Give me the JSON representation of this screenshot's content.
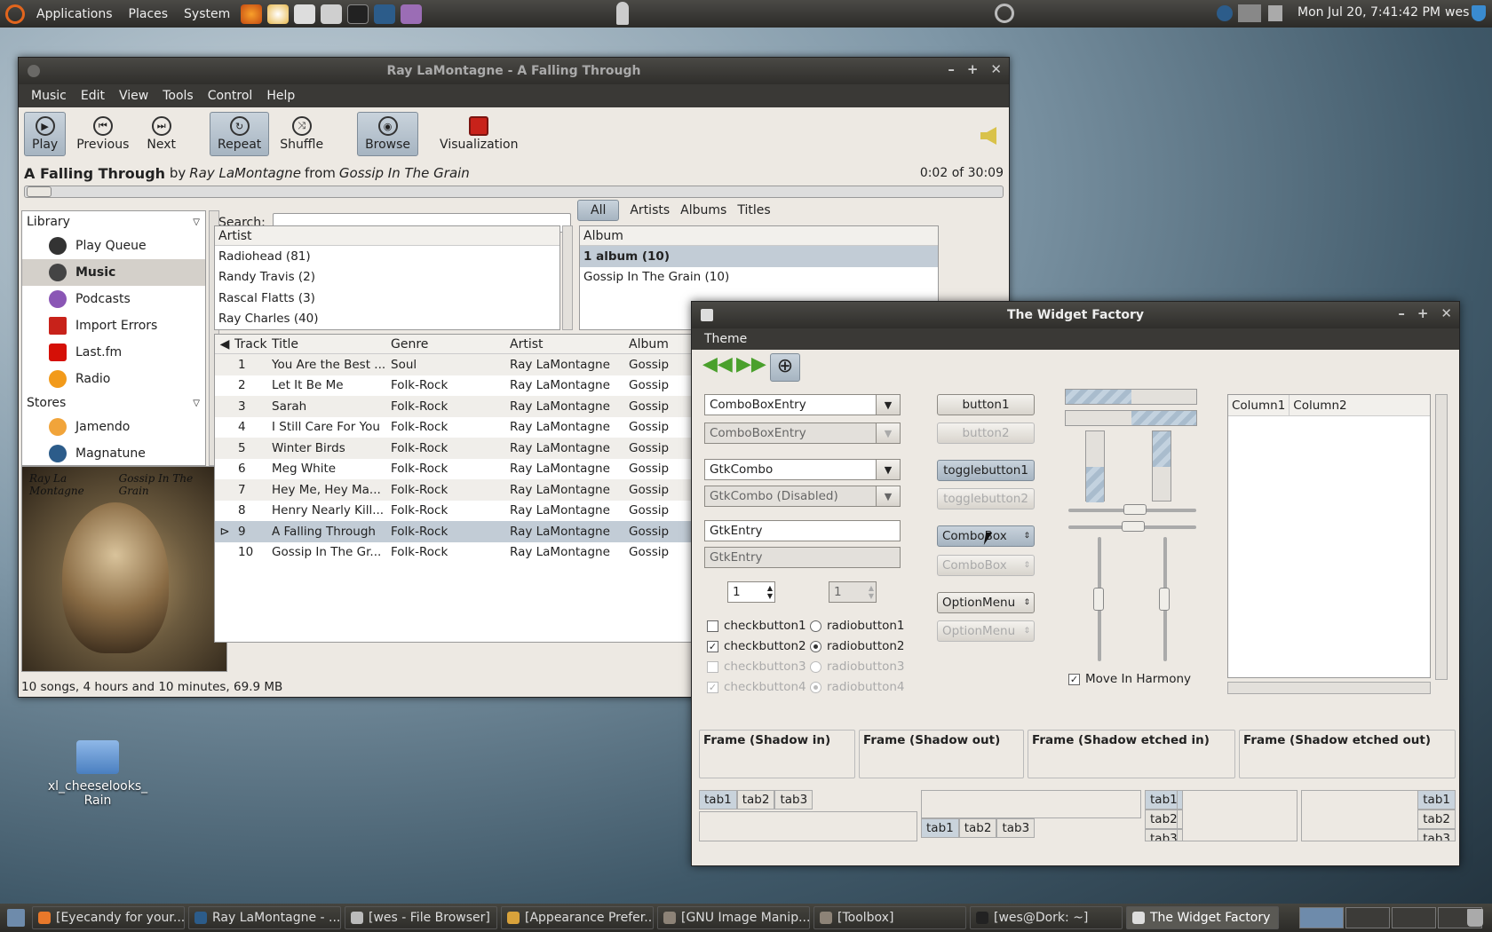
{
  "top_panel": {
    "menus": [
      "Applications",
      "Places",
      "System"
    ],
    "clock": "Mon Jul 20,  7:41:42 PM",
    "user": "wes"
  },
  "rhythmbox": {
    "title": "Ray LaMontagne - A Falling Through",
    "menus": [
      "Music",
      "Edit",
      "View",
      "Tools",
      "Control",
      "Help"
    ],
    "toolbar": [
      "Play",
      "Previous",
      "Next",
      "Repeat",
      "Shuffle",
      "Browse",
      "Visualization"
    ],
    "now_playing": {
      "title": "A Falling Through",
      "by": "by",
      "artist": "Ray LaMontagne",
      "from": "from",
      "album": "Gossip In The Grain",
      "time": "0:02 of 30:09"
    },
    "sidebar": {
      "library": "Library",
      "items": [
        "Play Queue",
        "Music",
        "Podcasts",
        "Import Errors",
        "Last.fm",
        "Radio"
      ],
      "stores": "Stores",
      "stores_items": [
        "Jamendo",
        "Magnatune"
      ]
    },
    "cover": {
      "left": "Ray La Montagne",
      "right": "Gossip In The Grain"
    },
    "search_label": "Search:",
    "browse_tabs": [
      "All",
      "Artists",
      "Albums",
      "Titles"
    ],
    "artist_header": "Artist",
    "artists": [
      "Radiohead (81)",
      "Randy Travis (2)",
      "Rascal Flatts (3)",
      "Ray Charles (40)"
    ],
    "album_header": "Album",
    "albums": [
      "1 album (10)",
      "Gossip In The Grain (10)"
    ],
    "track_headers": [
      "Track",
      "Title",
      "Genre",
      "Artist",
      "Album"
    ],
    "tracks": [
      [
        "1",
        "You Are the Best ...",
        "Soul",
        "Ray LaMontagne",
        "Gossip"
      ],
      [
        "2",
        "Let It Be Me",
        "Folk-Rock",
        "Ray LaMontagne",
        "Gossip"
      ],
      [
        "3",
        "Sarah",
        "Folk-Rock",
        "Ray LaMontagne",
        "Gossip"
      ],
      [
        "4",
        "I Still Care For You",
        "Folk-Rock",
        "Ray LaMontagne",
        "Gossip"
      ],
      [
        "5",
        "Winter Birds",
        "Folk-Rock",
        "Ray LaMontagne",
        "Gossip"
      ],
      [
        "6",
        "Meg White",
        "Folk-Rock",
        "Ray LaMontagne",
        "Gossip"
      ],
      [
        "7",
        "Hey Me, Hey Ma...",
        "Folk-Rock",
        "Ray LaMontagne",
        "Gossip"
      ],
      [
        "8",
        "Henry Nearly Kill...",
        "Folk-Rock",
        "Ray LaMontagne",
        "Gossip"
      ],
      [
        "9",
        "A Falling Through",
        "Folk-Rock",
        "Ray LaMontagne",
        "Gossip"
      ],
      [
        "10",
        "Gossip In The Gr...",
        "Folk-Rock",
        "Ray LaMontagne",
        "Gossip"
      ]
    ],
    "status": "10 songs, 4 hours and 10 minutes, 69.9 MB"
  },
  "widget_factory": {
    "title": "The Widget Factory",
    "menu": "Theme",
    "combo_entry": "ComboBoxEntry",
    "gtkcombo": "GtkCombo",
    "gtkcombo_disabled": "GtkCombo (Disabled)",
    "entry": "GtkEntry",
    "spin": "1",
    "checks": [
      "checkbutton1",
      "checkbutton2",
      "checkbutton3",
      "checkbutton4"
    ],
    "radios": [
      "radiobutton1",
      "radiobutton2",
      "radiobutton3",
      "radiobutton4"
    ],
    "buttons": [
      "button1",
      "button2"
    ],
    "toggles": [
      "togglebutton1",
      "togglebutton2"
    ],
    "combobox": "ComboBox",
    "optionmenu": "OptionMenu",
    "harmony": "Move In Harmony",
    "columns": [
      "Column1",
      "Column2"
    ],
    "frames": [
      "Frame (Shadow in)",
      "Frame (Shadow out)",
      "Frame (Shadow etched in)",
      "Frame (Shadow etched out)"
    ],
    "tabs": [
      "tab1",
      "tab2",
      "tab3"
    ]
  },
  "desktop_icon": {
    "label": "xl_cheeselooks_ Rain"
  },
  "taskbar": [
    "[Eyecandy for your...",
    "Ray LaMontagne - ...",
    "[wes - File Browser]",
    "[Appearance Prefer...",
    "[GNU Image Manip...",
    "[Toolbox]",
    "[wes@Dork: ~]",
    "The Widget Factory"
  ]
}
